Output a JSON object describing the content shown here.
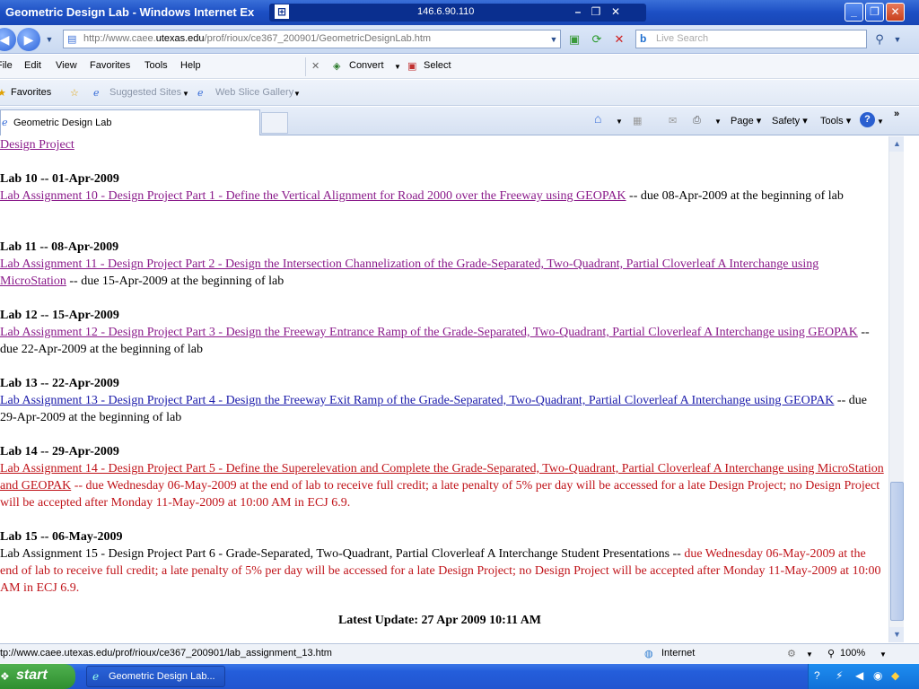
{
  "window": {
    "title": "Geometric Design Lab - Windows Internet Ex",
    "remote_host": "146.6.90.110"
  },
  "address": {
    "url_prefix": "http://www.caee.",
    "url_domain": "utexas.edu",
    "url_rest": "/prof/rioux/ce367_200901/GeometricDesignLab.htm",
    "search_placeholder": "Live Search"
  },
  "menu": {
    "items": [
      "File",
      "Edit",
      "View",
      "Favorites",
      "Tools",
      "Help"
    ],
    "convert": "Convert",
    "select": "Select"
  },
  "favorites_bar": {
    "favorites": "Favorites",
    "suggested": "Suggested Sites",
    "webslice": "Web Slice Gallery"
  },
  "command_bar": {
    "tab_title": "Geometric Design Lab",
    "page": "Page",
    "safety": "Safety",
    "tools": "Tools",
    "more": "»"
  },
  "content": {
    "top_link": "Design Project",
    "labs": [
      {
        "heading": "Lab 10 -- 01-Apr-2009",
        "link": "Lab Assignment 10 - Design Project Part 1 - Define the Vertical Alignment for Road 2000 over the Freeway using GEOPAK",
        "due": " -- due 08-Apr-2009 at the beginning of lab"
      },
      {
        "heading": "Lab 11 -- 08-Apr-2009",
        "link": "Lab Assignment 11 - Design Project Part 2 - Design the Intersection Channelization of the Grade-Separated, Two-Quadrant, Partial Cloverleaf A Interchange using MicroStation",
        "due": " -- due 15-Apr-2009 at the beginning of lab"
      },
      {
        "heading": "Lab 12 -- 15-Apr-2009",
        "link": "Lab Assignment 12 - Design Project Part 3 - Design the Freeway Entrance Ramp of the Grade-Separated, Two-Quadrant, Partial Cloverleaf A Interchange using GEOPAK",
        "due": " -- due 22-Apr-2009 at the beginning of lab"
      },
      {
        "heading": "Lab 13 -- 22-Apr-2009",
        "link": "Lab Assignment 13 - Design Project Part 4 - Design the Freeway Exit Ramp of the Grade-Separated, Two-Quadrant, Partial Cloverleaf A Interchange using GEOPAK",
        "due": " -- due 29-Apr-2009 at the beginning of lab"
      },
      {
        "heading": "Lab 14 -- 29-Apr-2009",
        "link": "Lab Assignment 14 - Design Project Part 5 - Define the Superelevation and Complete the Grade-Separated, Two-Quadrant, Partial Cloverleaf A Interchange using MicroStation and GEOPAK",
        "due": " -- due Wednesday 06-May-2009 at the end of lab to receive full credit; a late penalty of 5% per day will be accessed for a late Design Project; no Design Project will be accepted after Monday 11-May-2009 at 10:00 AM in ECJ 6.9."
      },
      {
        "heading": "Lab 15 -- 06-May-2009",
        "text": "Lab Assignment 15 - Design Project Part 6 - Grade-Separated, Two-Quadrant, Partial Cloverleaf A Interchange Student Presentations -- ",
        "due": "due Wednesday 06-May-2009 at the end of lab to receive full credit; a late penalty of 5% per day will be accessed for a late Design Project; no Design Project will be accepted after Monday 11-May-2009 at 10:00 AM in ECJ 6.9."
      }
    ],
    "latest_update": "Latest Update: 27 Apr 2009 10:11 AM"
  },
  "status": {
    "url": "tp://www.caee.utexas.edu/prof/rioux/ce367_200901/lab_assignment_13.htm",
    "zone": "Internet",
    "zoom": "100%"
  },
  "taskbar": {
    "start": "start",
    "task": "Geometric Design Lab..."
  }
}
